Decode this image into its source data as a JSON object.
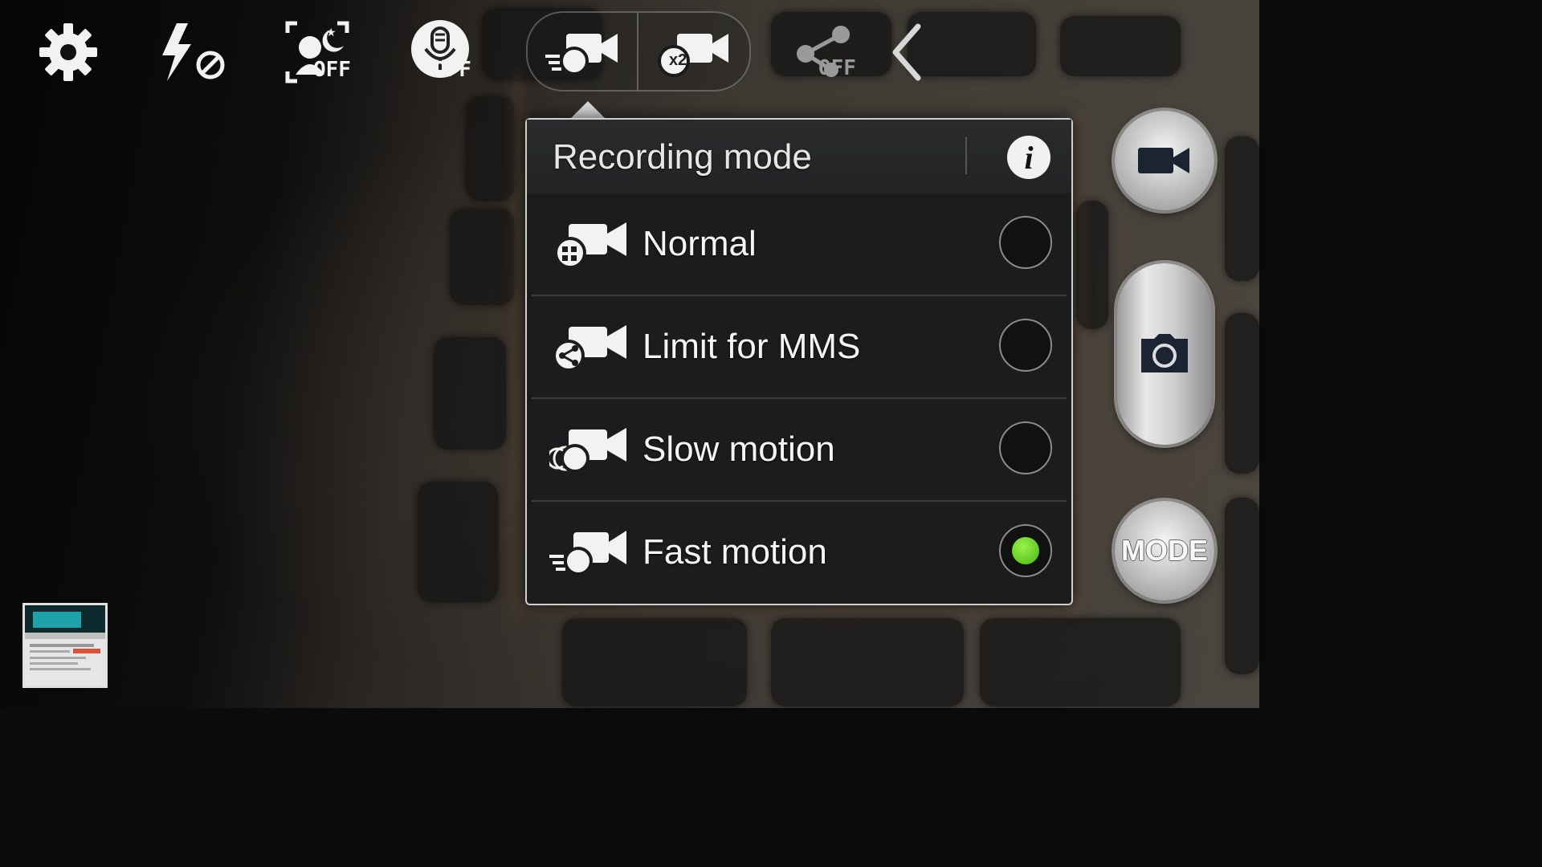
{
  "toolbar": {
    "settings_icon": "gear-icon",
    "flash_icon": "flash-off-icon",
    "face_detection_label": "OFF",
    "audio_zoom_label": "OFF",
    "share_label": "OFF",
    "recording_mode_icon": "fast-motion-camcorder-icon",
    "zoom_record_label": "x2",
    "collapse_icon": "chevron-left-icon"
  },
  "popup": {
    "title": "Recording mode",
    "info_label": "i",
    "options": [
      {
        "label": "Normal",
        "icon": "normal-camcorder-icon",
        "selected": false
      },
      {
        "label": "Limit for MMS",
        "icon": "mms-camcorder-icon",
        "selected": false
      },
      {
        "label": "Slow motion",
        "icon": "slow-motion-camcorder-icon",
        "selected": false
      },
      {
        "label": "Fast motion",
        "icon": "fast-motion-camcorder-icon",
        "selected": true
      }
    ]
  },
  "controls": {
    "record_icon": "video-camera-icon",
    "capture_icon": "camera-icon",
    "mode_label": "MODE"
  },
  "colors": {
    "selected_radio": "#5fd11e",
    "popup_background": "#1b1c1d",
    "popup_border": "#cfcfcf"
  }
}
